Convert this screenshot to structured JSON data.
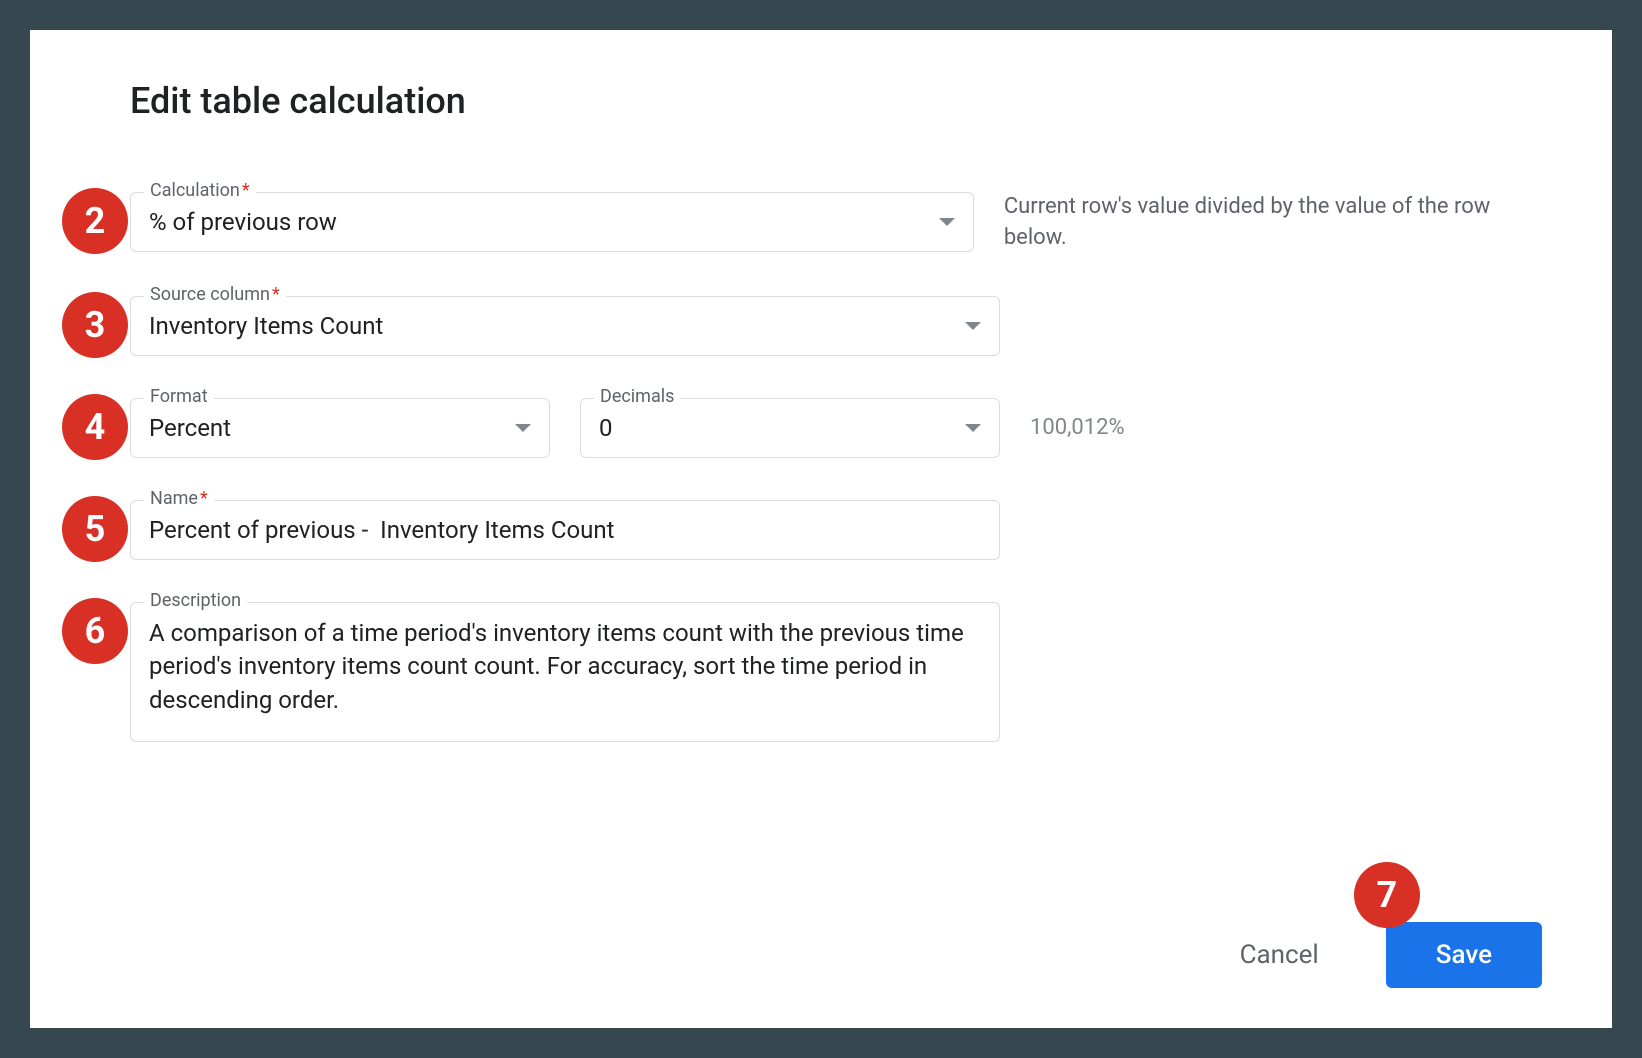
{
  "dialog": {
    "title": "Edit table calculation"
  },
  "badges": {
    "calculation": "2",
    "source": "3",
    "format": "4",
    "name": "5",
    "description": "6",
    "save": "7"
  },
  "fields": {
    "calculation": {
      "label": "Calculation",
      "required": "*",
      "value": "% of previous row",
      "help": "Current row's value divided by the value of the row below."
    },
    "source": {
      "label": "Source column",
      "required": "*",
      "value": "Inventory Items Count"
    },
    "format": {
      "label": "Format",
      "value": "Percent"
    },
    "decimals": {
      "label": "Decimals",
      "value": "0"
    },
    "format_sample": "100,012%",
    "name": {
      "label": "Name",
      "required": "*",
      "value": "Percent of previous -  Inventory Items Count"
    },
    "description": {
      "label": "Description",
      "value": "A comparison of a time period's inventory items count with the previous time period's inventory items count count. For accuracy, sort the time period in descending order."
    }
  },
  "buttons": {
    "cancel": "Cancel",
    "save": "Save"
  }
}
